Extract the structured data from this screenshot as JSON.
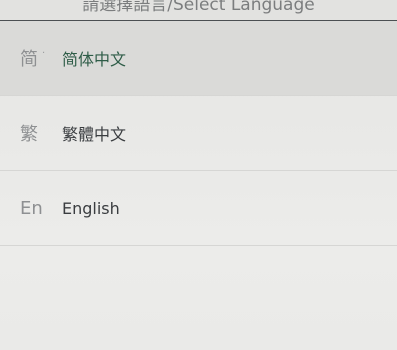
{
  "header": {
    "title": "請選擇語言/Select Language"
  },
  "languages": [
    {
      "abbr": "简",
      "label": "简体中文",
      "selected": true
    },
    {
      "abbr": "繁",
      "label": "繁體中文",
      "selected": false
    },
    {
      "abbr": "En",
      "label": "English",
      "selected": false
    }
  ]
}
